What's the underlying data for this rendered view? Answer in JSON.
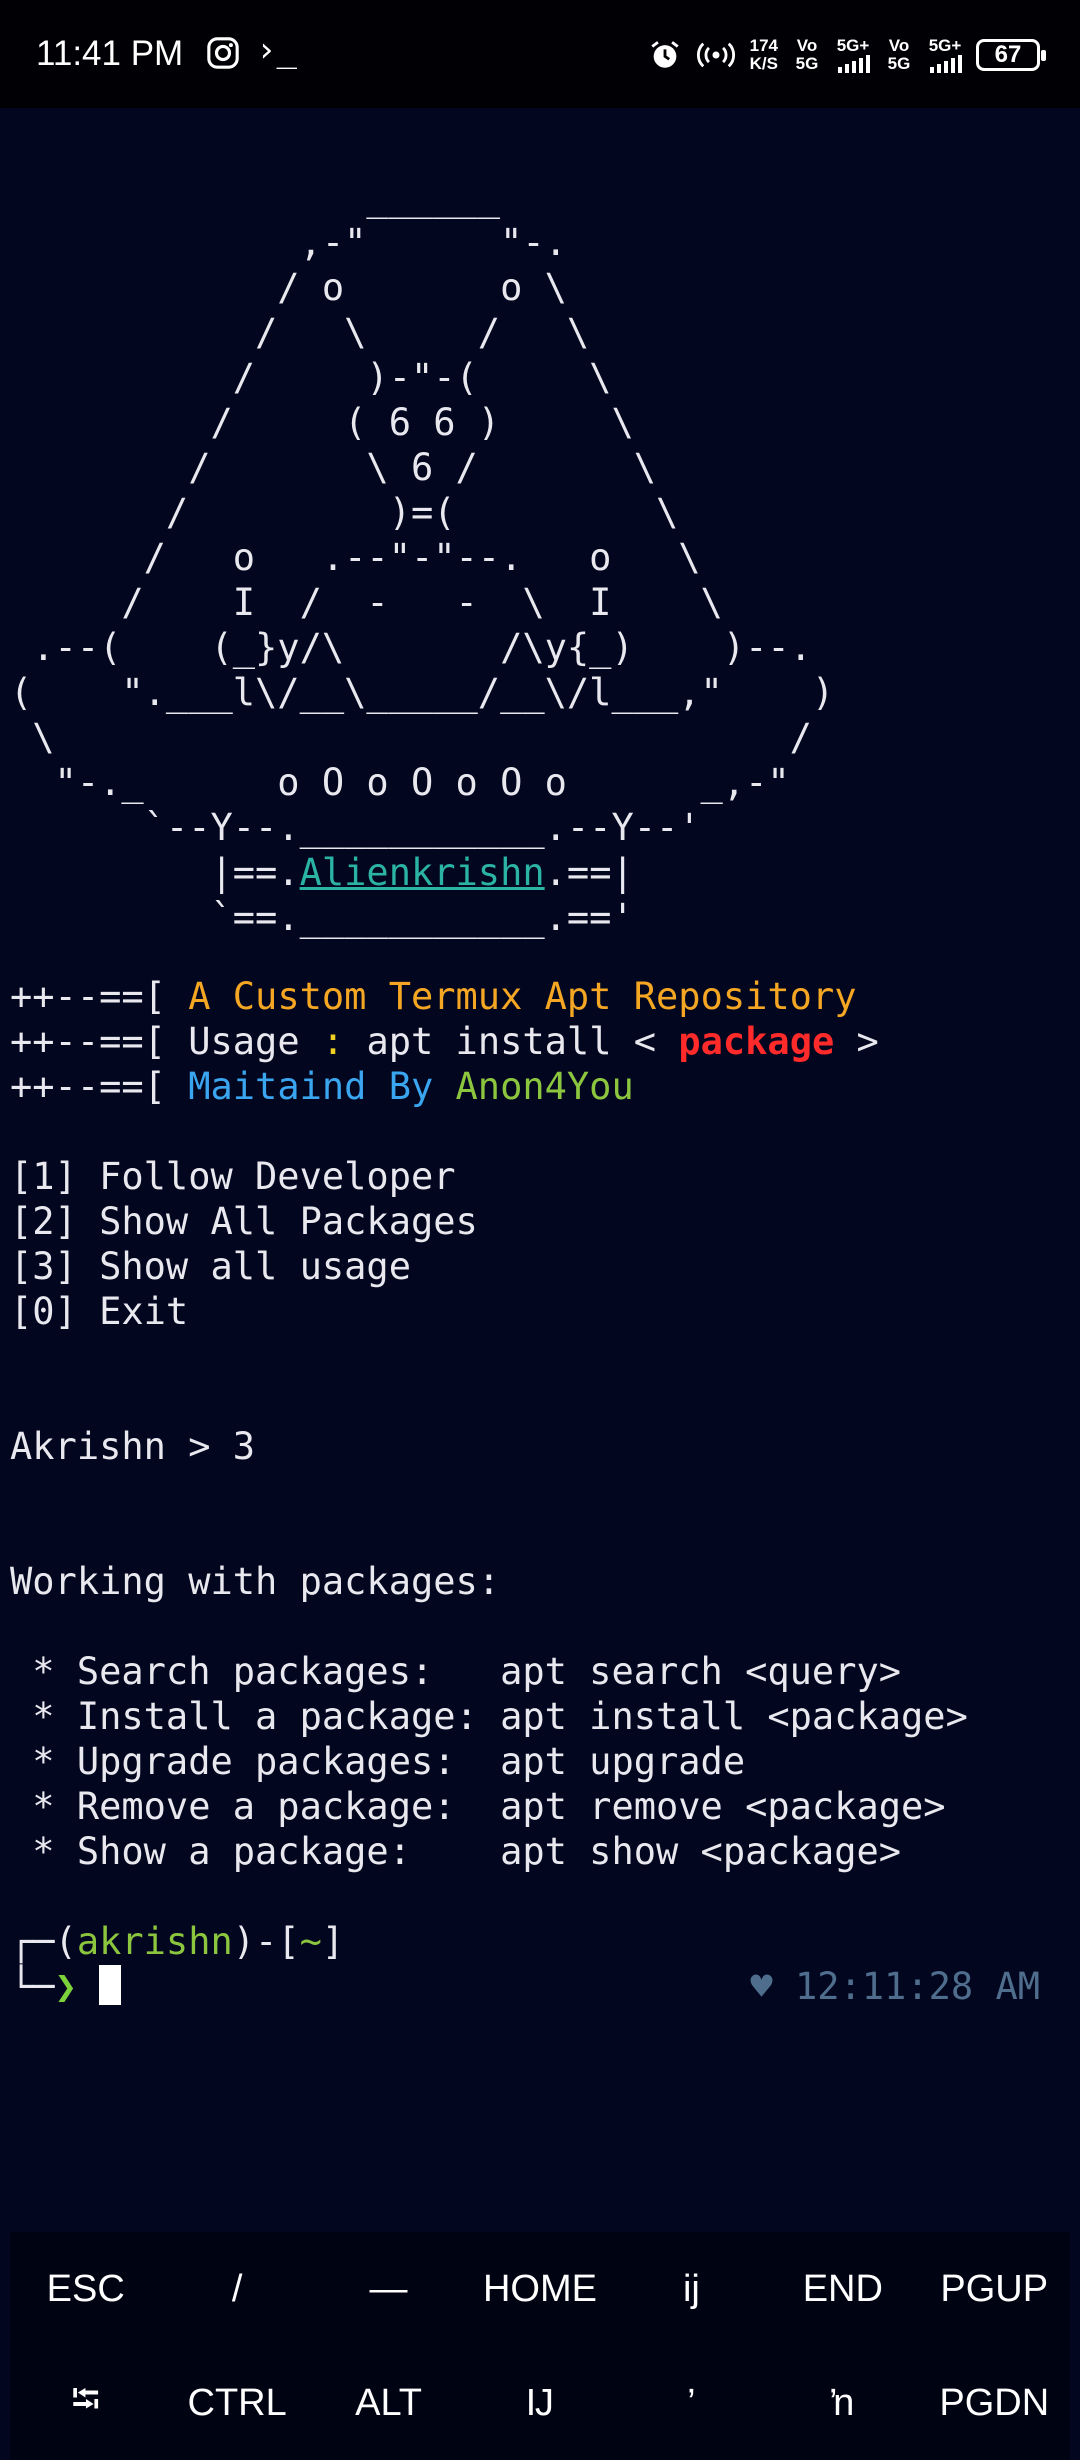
{
  "status_bar": {
    "time": "11:41 PM",
    "terminal_glyph": "›_",
    "net_speed_value": "174",
    "net_speed_unit": "K/S",
    "sim1_label": "Vo 5G",
    "sim1_network": "5G+",
    "sim2_label": "Vo 5G",
    "sim2_network": "5G+",
    "battery_level": "67",
    "icons": [
      "instagram-icon",
      "terminal-icon",
      "alarm-icon",
      "hotspot-icon",
      "signal-icon"
    ]
  },
  "ascii_art": [
    "                ______",
    "             ,-\"      \"-.",
    "            / o       o \\",
    "           /   \\     /   \\",
    "          /     )-\"-(     \\",
    "         /     ( 6 6 )     \\",
    "        /       \\ 6 /       \\",
    "       /         )=(         \\",
    "      /   o   .--\"-\"--.   o   \\",
    "     /    I  /  -   -  \\  I    \\",
    " .--(    (_}y/\\       /\\y{_)    )--.",
    "(    \".___l\\/__\\_____/__\\/l___,\"    )",
    " \\                                 /",
    "  \"-._      o O o O o O o      _,-\"",
    "      `--Y--.___________.--Y--'",
    "         |==.",
    "         `==.___________.=='"
  ],
  "banner": {
    "brand": "Alienkrishn",
    "brand_suffix": ".==|",
    "prefix": "++--==[ ",
    "line1_text": "A Custom Termux Apt Repository",
    "line2_label": "Usage",
    "line2_colon": " : ",
    "line2_cmd": "apt install < ",
    "line2_arg": "package",
    "line2_end": " >",
    "line3_label": "Maitaind By ",
    "line3_author": "Anon4You"
  },
  "menu": [
    "[1] Follow Developer",
    "[2] Show All Packages",
    "[3] Show all usage",
    "[0] Exit"
  ],
  "input_line": "Akrishn > 3",
  "usage_heading": "Working with packages:",
  "usage": [
    " * Search packages:   apt search <query>",
    " * Install a package: apt install <package>",
    " * Upgrade packages:  apt upgrade",
    " * Remove a package:  apt remove <package>",
    " * Show a package:    apt show <package>"
  ],
  "prompt": {
    "corner_top": "┌─(",
    "user": "akrishn",
    "mid": ")-[",
    "dir": "~",
    "end": "]",
    "corner_bottom": "└─",
    "arrow": "❯",
    "clock": "♥ 12:11:28 AM"
  },
  "extra_keys": {
    "row1": [
      "ESC",
      "/",
      "—",
      "HOME",
      "ij",
      "END",
      "PGUP"
    ],
    "row2": [
      "⭾",
      "CTRL",
      "ALT",
      "Ĳ",
      "’",
      "ŉ",
      "PGDN"
    ]
  },
  "colors": {
    "background": "#02061f",
    "orange": "#f5a623",
    "red": "#ff2a2a",
    "blue": "#3ba6f0",
    "green": "#8cc63f",
    "teal": "#2bb3a3"
  }
}
